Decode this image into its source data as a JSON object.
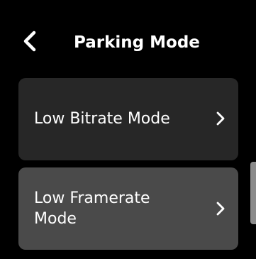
{
  "header": {
    "title": "Parking Mode",
    "back_icon": "chevron-left-icon"
  },
  "menu": {
    "items": [
      {
        "label": "Low Bitrate Mode",
        "icon": "chevron-right-icon"
      },
      {
        "label": "Low Framerate Mode",
        "icon": "chevron-right-icon"
      }
    ]
  },
  "colors": {
    "background": "#000000",
    "item_default": "#272727",
    "item_highlighted": "#4a4a4a",
    "text": "#ffffff",
    "scrollbar": "#8a8a8a"
  }
}
